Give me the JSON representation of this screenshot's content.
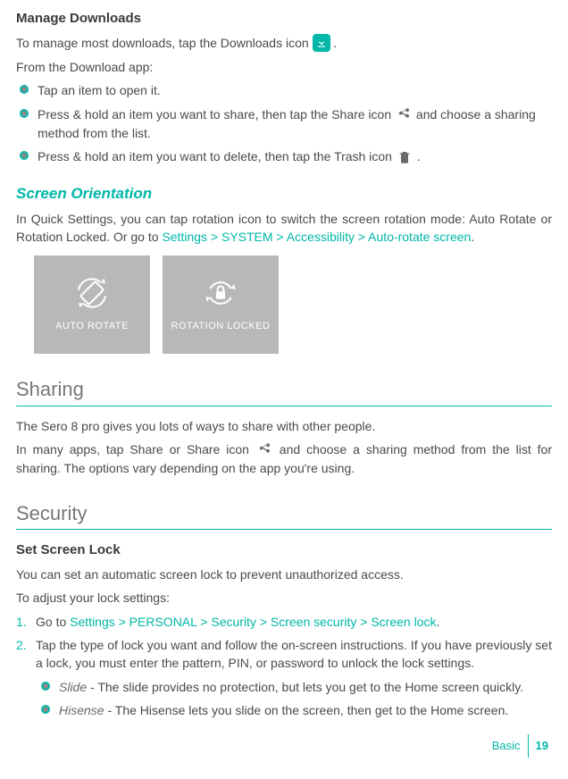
{
  "manage": {
    "heading": "Manage Downloads",
    "intro_pre": "To manage most downloads, tap the Downloads icon ",
    "intro_post": " .",
    "from_app": "From the Download app:",
    "bullets": [
      "Tap an item to open it.",
      "Press & hold an item you want to share, then tap the Share icon ",
      " and choose a sharing method from the list.",
      "Press & hold an item you want to delete, then tap the Trash icon ",
      " ."
    ]
  },
  "orientation": {
    "heading": "Screen Orientation",
    "body_pre": "In Quick Settings, you can tap rotation icon to switch the screen rotation mode: Auto Rotate or Rotation Locked. Or go to ",
    "path": "Settings > SYSTEM > Accessibility > Auto-rotate screen",
    "body_post": ".",
    "tile1": "AUTO ROTATE",
    "tile2": "ROTATION LOCKED"
  },
  "sharing": {
    "heading": "Sharing",
    "p1": "The Sero 8 pro gives you lots of ways to share with other people.",
    "p2_pre": "In many apps, tap Share or Share icon ",
    "p2_post": " and choose a sharing method from the list for sharing. The options vary depending on the app you're using."
  },
  "security": {
    "heading": "Security",
    "sub": "Set Screen Lock",
    "p1": "You can set an automatic screen lock to prevent unauthorized access.",
    "p2": "To adjust your lock settings:",
    "li1_pre": "Go to ",
    "li1_path": "Settings > PERSONAL > Security > Screen security > Screen lock",
    "li1_post": ".",
    "li2": "Tap the type of lock you want and follow the on-screen instructions. If you have previously set a lock, you must enter the pattern, PIN, or password to unlock the lock settings.",
    "sub_b1_label": "Slide",
    "sub_b1_text": " - The slide provides no protection, but lets you get to the Home screen quickly.",
    "sub_b2_label": "Hisense",
    "sub_b2_text": " - The Hisense lets you slide on the screen, then get to the Home screen."
  },
  "footer": {
    "label": "Basic",
    "page": "19"
  }
}
